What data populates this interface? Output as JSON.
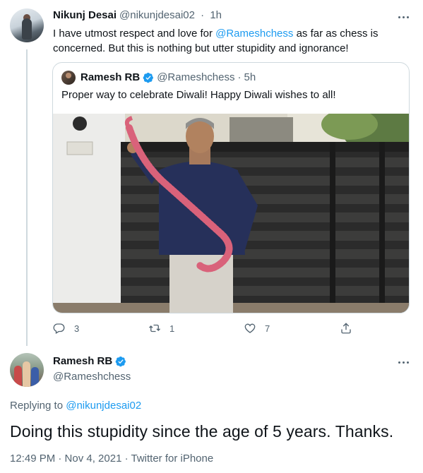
{
  "tweet1": {
    "author_name": "Nikunj Desai",
    "author_handle": "@nikunjdesai02",
    "separator": "·",
    "time_ago": "1h",
    "text_before": "I have utmost respect and love for ",
    "mention": "@Rameshchess",
    "text_after": " as far as chess is concerned. But this is nothing but utter stupidity and ignorance!"
  },
  "quote": {
    "author_name": "Ramesh RB",
    "author_handle": "@Rameshchess",
    "separator": "·",
    "time_ago": "5h",
    "text": "Proper way to celebrate Diwali! Happy Diwali wishes to all!"
  },
  "actions": {
    "replies": "3",
    "retweets": "1",
    "likes": "7"
  },
  "tweet2": {
    "author_name": "Ramesh RB",
    "author_handle": "@Rameshchess",
    "replying_label": "Replying to ",
    "replying_handle": "@nikunjdesai02",
    "text": "Doing this stupidity since the age of 5 years. Thanks.",
    "timestamp": "12:49 PM · Nov 4, 2021 · Twitter for iPhone"
  },
  "icons": [
    "more-icon",
    "verified-badge-icon",
    "reply-icon",
    "retweet-icon",
    "like-icon",
    "share-icon"
  ],
  "colors": {
    "accent": "#1d9bf0",
    "text": "#0f1419",
    "secondary": "#536471",
    "border": "#cfd9de"
  }
}
